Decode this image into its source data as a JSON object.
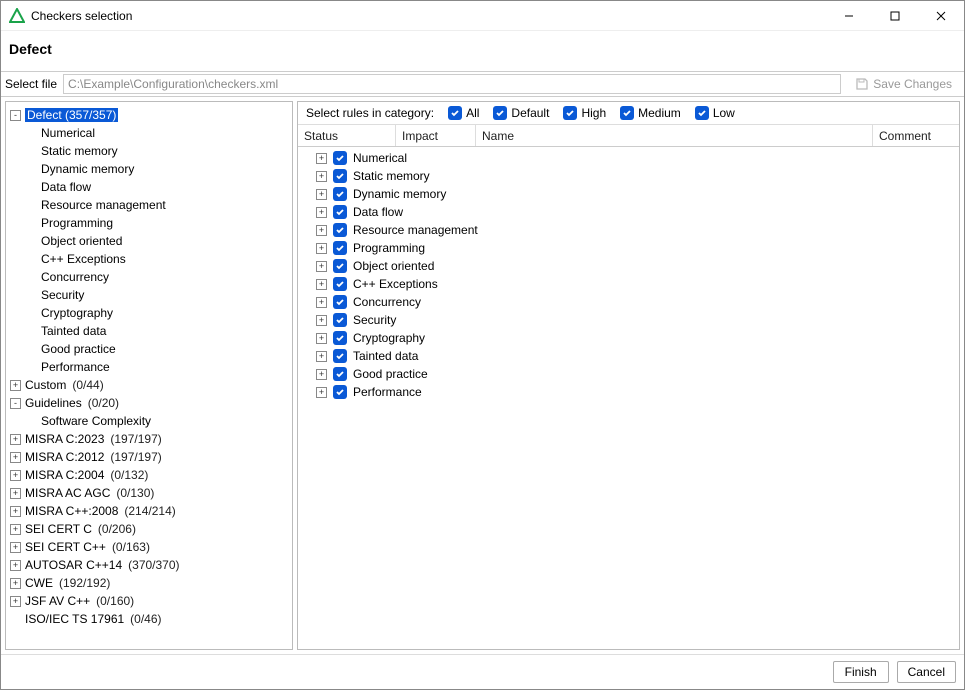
{
  "window": {
    "title": "Checkers selection",
    "minimize": "–",
    "maximize": "▢",
    "close": "✕"
  },
  "header": {
    "title": "Defect"
  },
  "file": {
    "label": "Select file",
    "path": "C:\\Example\\Configuration\\checkers.xml",
    "save_label": "Save Changes"
  },
  "tree": {
    "nodes": [
      {
        "expander": "-",
        "label": "Defect",
        "count": "(357/357)",
        "selected": true,
        "children": [
          {
            "label": "Numerical"
          },
          {
            "label": "Static memory"
          },
          {
            "label": "Dynamic memory"
          },
          {
            "label": "Data flow"
          },
          {
            "label": "Resource management"
          },
          {
            "label": "Programming"
          },
          {
            "label": "Object oriented"
          },
          {
            "label": "C++ Exceptions"
          },
          {
            "label": "Concurrency"
          },
          {
            "label": "Security"
          },
          {
            "label": "Cryptography"
          },
          {
            "label": "Tainted data"
          },
          {
            "label": "Good practice"
          },
          {
            "label": "Performance"
          }
        ]
      },
      {
        "expander": "+",
        "label": "Custom",
        "count": "(0/44)"
      },
      {
        "expander": "-",
        "label": "Guidelines",
        "count": "(0/20)",
        "children": [
          {
            "label": "Software Complexity"
          }
        ]
      },
      {
        "expander": "+",
        "label": "MISRA C:2023",
        "count": "(197/197)"
      },
      {
        "expander": "+",
        "label": "MISRA C:2012",
        "count": "(197/197)"
      },
      {
        "expander": "+",
        "label": "MISRA C:2004",
        "count": "(0/132)"
      },
      {
        "expander": "+",
        "label": "MISRA AC AGC",
        "count": "(0/130)"
      },
      {
        "expander": "+",
        "label": "MISRA C++:2008",
        "count": "(214/214)"
      },
      {
        "expander": "+",
        "label": "SEI CERT C",
        "count": "(0/206)"
      },
      {
        "expander": "+",
        "label": "SEI CERT C++",
        "count": "(0/163)"
      },
      {
        "expander": "+",
        "label": "AUTOSAR C++14",
        "count": "(370/370)"
      },
      {
        "expander": "+",
        "label": "CWE",
        "count": "(192/192)"
      },
      {
        "expander": "+",
        "label": "JSF AV C++",
        "count": "(0/160)"
      },
      {
        "expander": "",
        "label": "ISO/IEC TS 17961",
        "count": "(0/46)"
      }
    ]
  },
  "filters": {
    "label": "Select rules in category:",
    "options": [
      {
        "label": "All"
      },
      {
        "label": "Default"
      },
      {
        "label": "High"
      },
      {
        "label": "Medium"
      },
      {
        "label": "Low"
      }
    ]
  },
  "columns": {
    "status": "Status",
    "impact": "Impact",
    "name": "Name",
    "comment": "Comment"
  },
  "rules": [
    {
      "name": "Numerical"
    },
    {
      "name": "Static memory"
    },
    {
      "name": "Dynamic memory"
    },
    {
      "name": "Data flow"
    },
    {
      "name": "Resource management"
    },
    {
      "name": "Programming"
    },
    {
      "name": "Object oriented"
    },
    {
      "name": "C++ Exceptions"
    },
    {
      "name": "Concurrency"
    },
    {
      "name": "Security"
    },
    {
      "name": "Cryptography"
    },
    {
      "name": "Tainted data"
    },
    {
      "name": "Good practice"
    },
    {
      "name": "Performance"
    }
  ],
  "footer": {
    "finish": "Finish",
    "cancel": "Cancel"
  }
}
